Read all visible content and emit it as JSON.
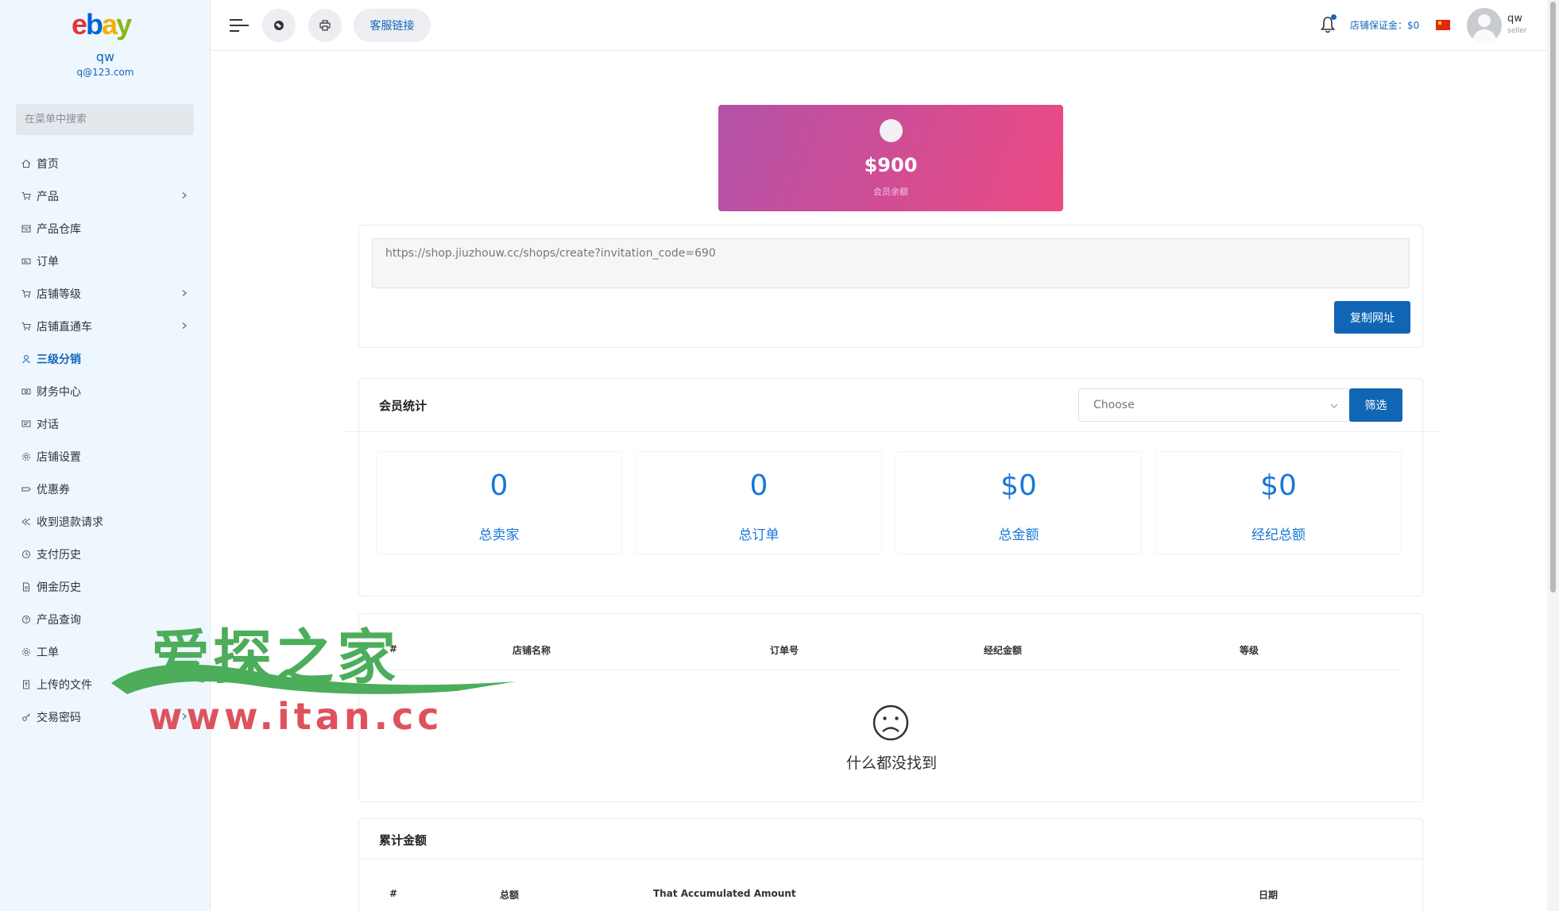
{
  "sidebar": {
    "user_name": "qw",
    "user_email": "q@123.com",
    "search_placeholder": "在菜单中搜索",
    "items": [
      {
        "label": "首页",
        "icon": "home-icon",
        "has_chevron": false,
        "active": false
      },
      {
        "label": "产品",
        "icon": "cart-icon",
        "has_chevron": true,
        "active": false
      },
      {
        "label": "产品仓库",
        "icon": "warehouse-icon",
        "has_chevron": false,
        "active": false
      },
      {
        "label": "订单",
        "icon": "order-icon",
        "has_chevron": false,
        "active": false
      },
      {
        "label": "店铺等级",
        "icon": "cart-icon",
        "has_chevron": true,
        "active": false
      },
      {
        "label": "店铺直通车",
        "icon": "cart-icon",
        "has_chevron": true,
        "active": false
      },
      {
        "label": "三级分销",
        "icon": "user-icon",
        "has_chevron": false,
        "active": true
      },
      {
        "label": "财务中心",
        "icon": "money-icon",
        "has_chevron": false,
        "active": false
      },
      {
        "label": "对话",
        "icon": "chat-icon",
        "has_chevron": false,
        "active": false
      },
      {
        "label": "店铺设置",
        "icon": "gear-icon",
        "has_chevron": false,
        "active": false
      },
      {
        "label": "优惠券",
        "icon": "coupon-icon",
        "has_chevron": false,
        "active": false
      },
      {
        "label": "收到退款请求",
        "icon": "refund-icon",
        "has_chevron": false,
        "active": false
      },
      {
        "label": "支付历史",
        "icon": "history-icon",
        "has_chevron": false,
        "active": false
      },
      {
        "label": "佣金历史",
        "icon": "file-icon",
        "has_chevron": false,
        "active": false
      },
      {
        "label": "产品查询",
        "icon": "question-icon",
        "has_chevron": false,
        "active": false
      },
      {
        "label": "工单",
        "icon": "gear-icon",
        "has_chevron": false,
        "active": false
      },
      {
        "label": "上传的文件",
        "icon": "upload-file-icon",
        "has_chevron": false,
        "active": false
      },
      {
        "label": "交易密码",
        "icon": "key-icon",
        "has_chevron": true,
        "active": false
      }
    ]
  },
  "header": {
    "customer_service_label": "客服链接",
    "deposit_text": "店铺保证金：$0",
    "user_name": "qw",
    "user_role": "seller"
  },
  "balance": {
    "amount": "$900",
    "label": "会员余额"
  },
  "invite": {
    "url": "https://shop.jiuzhouw.cc/shops/create?invitation_code=690",
    "copy_label": "复制网址"
  },
  "stats": {
    "title": "会员统计",
    "select_value": "Choose",
    "filter_label": "筛选",
    "boxes": [
      {
        "value": "0",
        "label": "总卖家"
      },
      {
        "value": "0",
        "label": "总订单"
      },
      {
        "value": "$0",
        "label": "总金额"
      },
      {
        "value": "$0",
        "label": "经纪总额"
      }
    ]
  },
  "member_table": {
    "columns": [
      "#",
      "店铺名称",
      "订单号",
      "经纪金额",
      "等级"
    ],
    "empty_text": "什么都没找到"
  },
  "accumulated": {
    "title": "累计金额",
    "columns": [
      "#",
      "总额",
      "That Accumulated Amount",
      "日期"
    ]
  },
  "watermark": {
    "text_cn": "爱探之家",
    "text_url": "www.itan.cc"
  },
  "colors": {
    "primary": "#1066b5",
    "link_blue": "#1466b8",
    "stat_blue": "#1777d8",
    "sidebar_bg": "#eef7fe",
    "balance_gradient_start": "#b352a8",
    "balance_gradient_end": "#ec4a82"
  }
}
